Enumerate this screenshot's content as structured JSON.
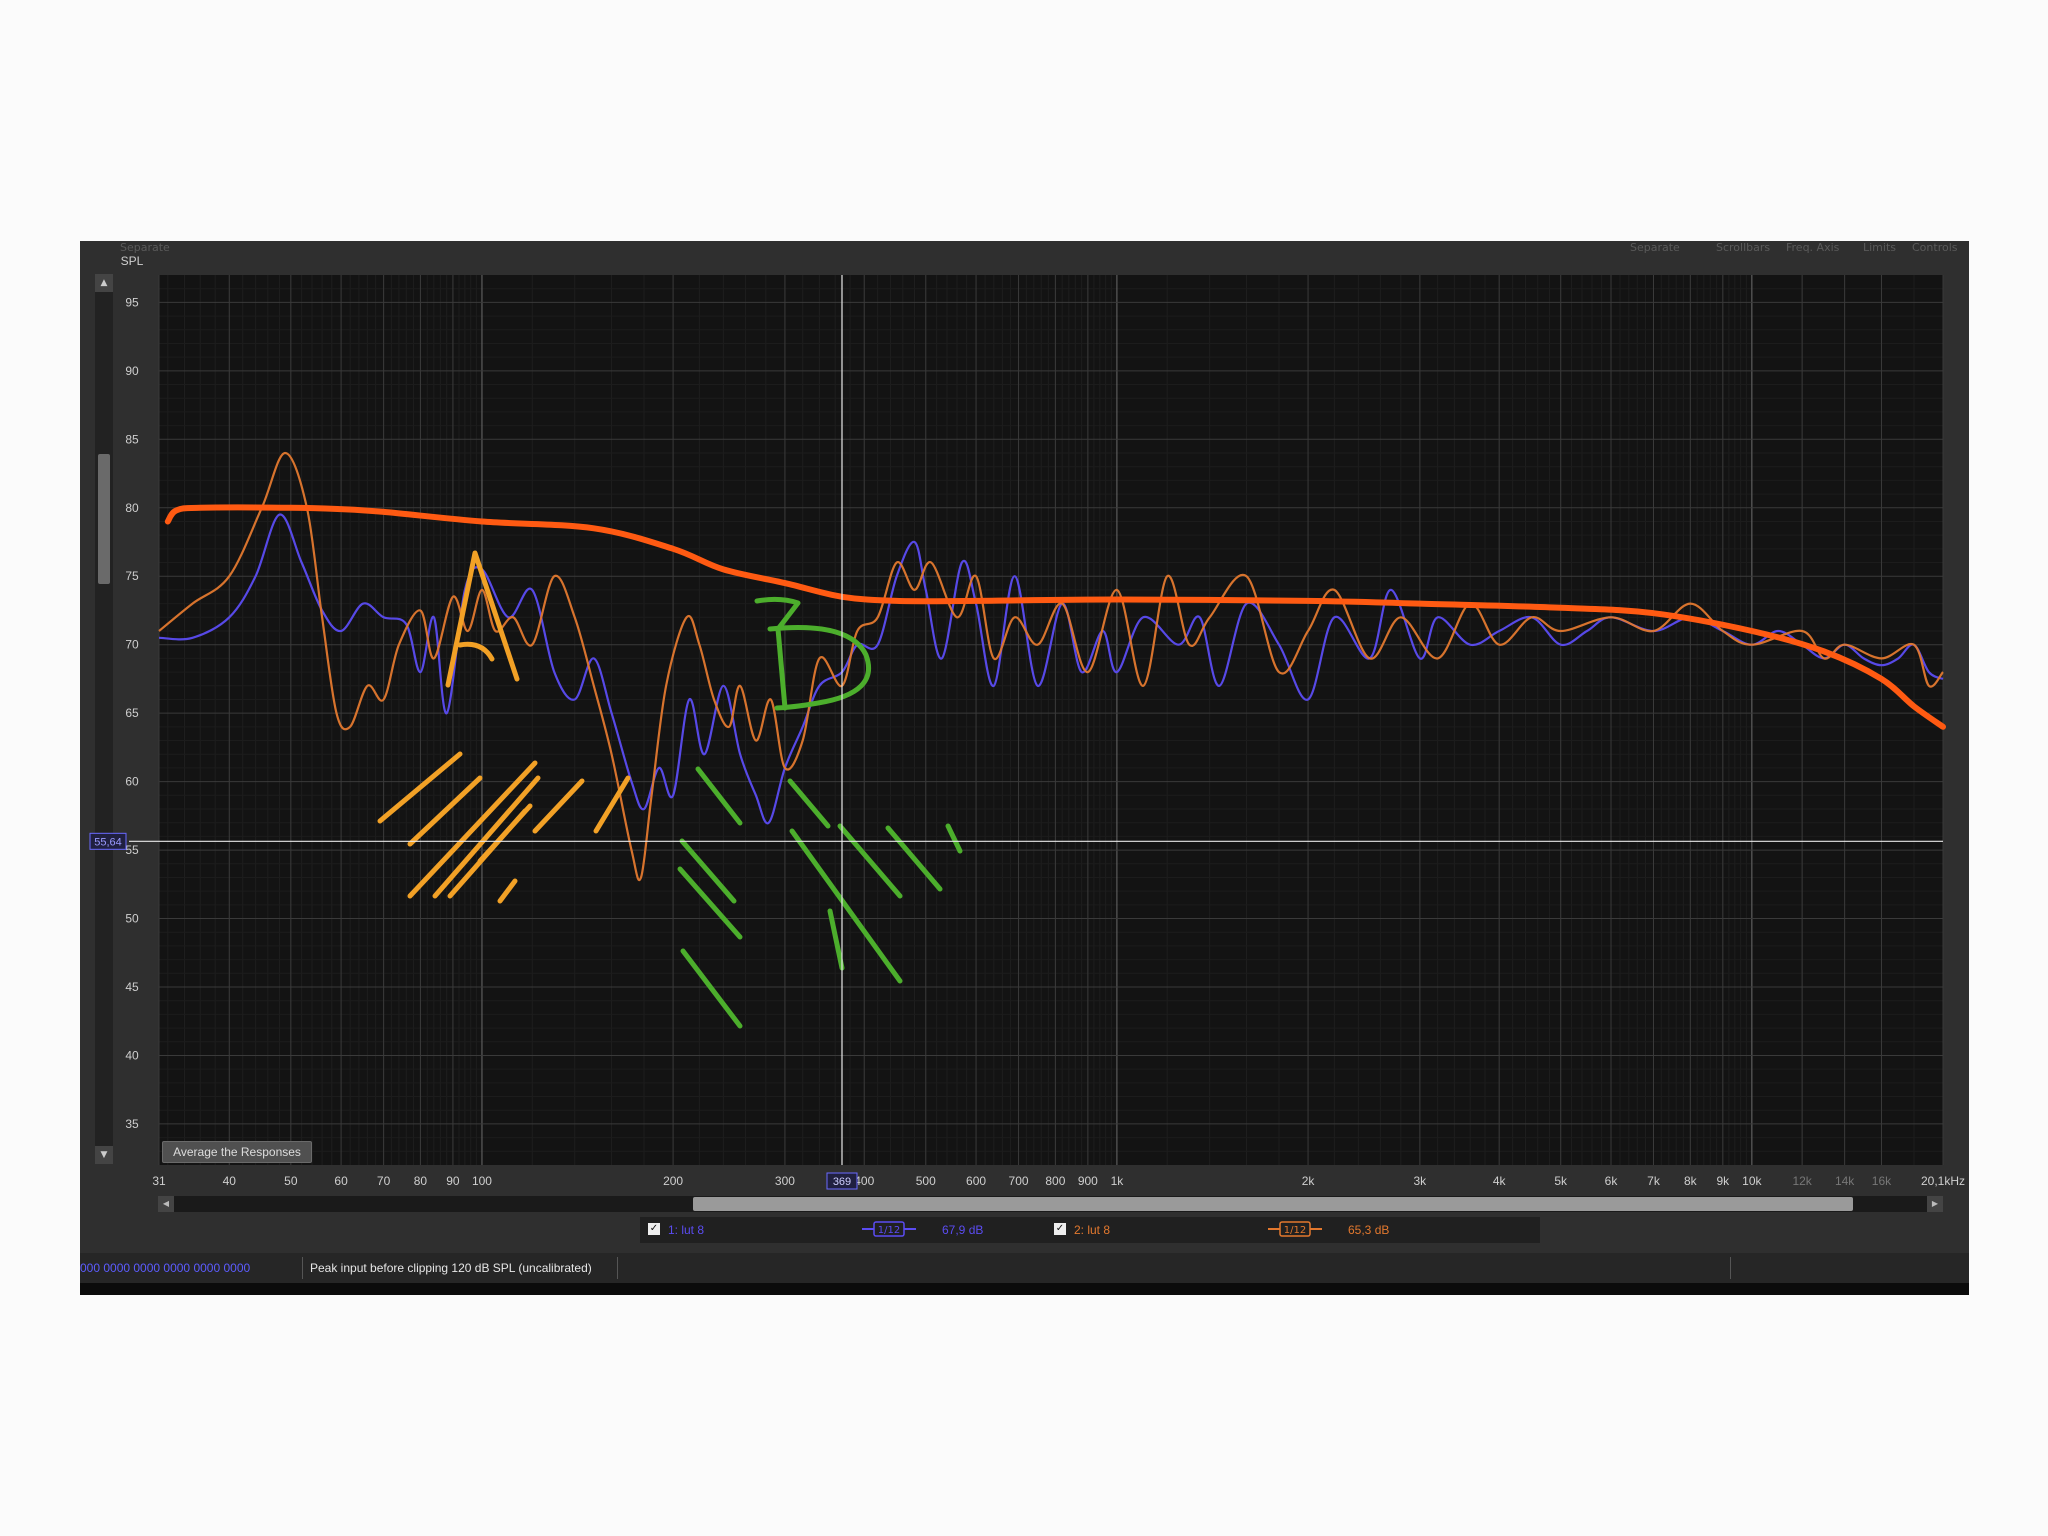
{
  "toolbar": {
    "left_label": "Separate",
    "right_labels": [
      "Separate",
      "Scrollbars",
      "Freq. Axis",
      "Limits",
      "Controls"
    ]
  },
  "colors": {
    "series1": "#5b4cf2",
    "series2": "#e2782e",
    "average": "#ff5a12",
    "annotation_a": "#f2a126",
    "annotation_b": "#4cae2c",
    "grid": "#3a3a3a",
    "plot_bg": "#131313"
  },
  "chart_data": {
    "type": "line",
    "xscale": "log",
    "xlim": [
      31,
      20000
    ],
    "ylim": [
      32,
      97
    ],
    "ylabel": "SPL",
    "yticks": [
      35,
      40,
      45,
      50,
      55,
      60,
      65,
      70,
      75,
      80,
      85,
      90,
      95
    ],
    "xticks": [
      {
        "v": 31,
        "l": "31"
      },
      {
        "v": 40,
        "l": "40"
      },
      {
        "v": 50,
        "l": "50"
      },
      {
        "v": 60,
        "l": "60"
      },
      {
        "v": 70,
        "l": "70"
      },
      {
        "v": 80,
        "l": "80"
      },
      {
        "v": 90,
        "l": "90"
      },
      {
        "v": 100,
        "l": "100"
      },
      {
        "v": 200,
        "l": "200"
      },
      {
        "v": 300,
        "l": "300"
      },
      {
        "v": 400,
        "l": "400"
      },
      {
        "v": 500,
        "l": "500"
      },
      {
        "v": 600,
        "l": "600"
      },
      {
        "v": 700,
        "l": "700"
      },
      {
        "v": 800,
        "l": "800"
      },
      {
        "v": 900,
        "l": "900"
      },
      {
        "v": 1000,
        "l": "1k"
      },
      {
        "v": 2000,
        "l": "2k"
      },
      {
        "v": 3000,
        "l": "3k"
      },
      {
        "v": 4000,
        "l": "4k"
      },
      {
        "v": 5000,
        "l": "5k"
      },
      {
        "v": 6000,
        "l": "6k"
      },
      {
        "v": 7000,
        "l": "7k"
      },
      {
        "v": 8000,
        "l": "8k"
      },
      {
        "v": 9000,
        "l": "9k"
      },
      {
        "v": 10000,
        "l": "10k"
      },
      {
        "v": 12000,
        "l": "12k"
      },
      {
        "v": 14000,
        "l": "14k"
      },
      {
        "v": 16000,
        "l": "16k"
      },
      {
        "v": 20000,
        "l": "20,1kHz"
      }
    ],
    "cursor": {
      "x": 369,
      "x_label": "369",
      "y": 55.64,
      "y_label": "55,64"
    },
    "series": [
      {
        "name": "1: lut 8",
        "smoothing": "1/12",
        "level": "67,9 dB",
        "points": [
          [
            31,
            70.5
          ],
          [
            35,
            70.5
          ],
          [
            40,
            72
          ],
          [
            44,
            75
          ],
          [
            48,
            79.5
          ],
          [
            52,
            76
          ],
          [
            56,
            72.5
          ],
          [
            60,
            71
          ],
          [
            65,
            73
          ],
          [
            70,
            72
          ],
          [
            76,
            71.5
          ],
          [
            80,
            68
          ],
          [
            84,
            72
          ],
          [
            88,
            65
          ],
          [
            94,
            74
          ],
          [
            100,
            75.5
          ],
          [
            110,
            72
          ],
          [
            120,
            74
          ],
          [
            130,
            68
          ],
          [
            140,
            66
          ],
          [
            150,
            69
          ],
          [
            160,
            65
          ],
          [
            172,
            60
          ],
          [
            180,
            58
          ],
          [
            190,
            61
          ],
          [
            200,
            59
          ],
          [
            212,
            66
          ],
          [
            224,
            62
          ],
          [
            240,
            67
          ],
          [
            255,
            62
          ],
          [
            270,
            59
          ],
          [
            283,
            57
          ],
          [
            300,
            61
          ],
          [
            320,
            64
          ],
          [
            340,
            67
          ],
          [
            369,
            68
          ],
          [
            390,
            70
          ],
          [
            420,
            70
          ],
          [
            450,
            75
          ],
          [
            480,
            77.5
          ],
          [
            500,
            74
          ],
          [
            530,
            69
          ],
          [
            570,
            76
          ],
          [
            600,
            73
          ],
          [
            640,
            67
          ],
          [
            690,
            75
          ],
          [
            750,
            67
          ],
          [
            820,
            73
          ],
          [
            880,
            68
          ],
          [
            950,
            71
          ],
          [
            1000,
            68
          ],
          [
            1100,
            72
          ],
          [
            1250,
            70
          ],
          [
            1350,
            72
          ],
          [
            1450,
            67
          ],
          [
            1600,
            73
          ],
          [
            1800,
            70
          ],
          [
            2000,
            66
          ],
          [
            2200,
            72
          ],
          [
            2500,
            69
          ],
          [
            2700,
            74
          ],
          [
            3000,
            69
          ],
          [
            3200,
            72
          ],
          [
            3600,
            70
          ],
          [
            4000,
            71
          ],
          [
            4500,
            72
          ],
          [
            5000,
            70
          ],
          [
            5500,
            71
          ],
          [
            6000,
            72
          ],
          [
            7000,
            71
          ],
          [
            8000,
            72
          ],
          [
            9000,
            71
          ],
          [
            10000,
            70
          ],
          [
            11000,
            71
          ],
          [
            12000,
            70
          ],
          [
            13000,
            69
          ],
          [
            14000,
            70
          ],
          [
            15000,
            69
          ],
          [
            16000,
            68.5
          ],
          [
            17000,
            69
          ],
          [
            18000,
            70
          ],
          [
            19000,
            68
          ],
          [
            20000,
            67.5
          ]
        ]
      },
      {
        "name": "2: lut 8",
        "smoothing": "1/12",
        "level": "65,3 dB",
        "points": [
          [
            31,
            71
          ],
          [
            35,
            73
          ],
          [
            40,
            75
          ],
          [
            45,
            80
          ],
          [
            49,
            84
          ],
          [
            53,
            80
          ],
          [
            56,
            72
          ],
          [
            59,
            65
          ],
          [
            62,
            64
          ],
          [
            66,
            67
          ],
          [
            70,
            66
          ],
          [
            74,
            70
          ],
          [
            80,
            72.5
          ],
          [
            84,
            69
          ],
          [
            90,
            73.5
          ],
          [
            95,
            71
          ],
          [
            100,
            74
          ],
          [
            105,
            71
          ],
          [
            112,
            72
          ],
          [
            120,
            70
          ],
          [
            130,
            75
          ],
          [
            140,
            72
          ],
          [
            150,
            67
          ],
          [
            160,
            62
          ],
          [
            172,
            55
          ],
          [
            178,
            53
          ],
          [
            185,
            59
          ],
          [
            195,
            67
          ],
          [
            210,
            72
          ],
          [
            220,
            70
          ],
          [
            232,
            66
          ],
          [
            245,
            64
          ],
          [
            255,
            67
          ],
          [
            270,
            63
          ],
          [
            285,
            66
          ],
          [
            300,
            61
          ],
          [
            320,
            63
          ],
          [
            340,
            69
          ],
          [
            369,
            67
          ],
          [
            390,
            71
          ],
          [
            420,
            72
          ],
          [
            450,
            76
          ],
          [
            480,
            74
          ],
          [
            510,
            76
          ],
          [
            560,
            72
          ],
          [
            600,
            75
          ],
          [
            640,
            69
          ],
          [
            690,
            72
          ],
          [
            750,
            70
          ],
          [
            820,
            73
          ],
          [
            900,
            68
          ],
          [
            1000,
            74
          ],
          [
            1100,
            67
          ],
          [
            1200,
            75
          ],
          [
            1300,
            70
          ],
          [
            1400,
            72
          ],
          [
            1600,
            75
          ],
          [
            1800,
            68
          ],
          [
            2000,
            71
          ],
          [
            2200,
            74
          ],
          [
            2500,
            69
          ],
          [
            2800,
            72
          ],
          [
            3200,
            69
          ],
          [
            3600,
            73
          ],
          [
            4000,
            70
          ],
          [
            4500,
            72
          ],
          [
            5000,
            71
          ],
          [
            6000,
            72
          ],
          [
            7000,
            71
          ],
          [
            8000,
            73
          ],
          [
            9000,
            71
          ],
          [
            10000,
            70
          ],
          [
            12000,
            71
          ],
          [
            13000,
            69
          ],
          [
            14000,
            70
          ],
          [
            16000,
            69
          ],
          [
            18000,
            70
          ],
          [
            19000,
            67
          ],
          [
            20000,
            68
          ]
        ]
      }
    ],
    "average": {
      "points": [
        [
          32,
          79
        ],
        [
          33,
          79.8
        ],
        [
          36,
          80
        ],
        [
          50,
          80
        ],
        [
          60,
          79.9
        ],
        [
          70,
          79.7
        ],
        [
          100,
          79
        ],
        [
          150,
          78.5
        ],
        [
          200,
          77
        ],
        [
          240,
          75.5
        ],
        [
          300,
          74.5
        ],
        [
          369,
          73.5
        ],
        [
          450,
          73.2
        ],
        [
          600,
          73.2
        ],
        [
          1000,
          73.3
        ],
        [
          2000,
          73.2
        ],
        [
          3000,
          73
        ],
        [
          5000,
          72.7
        ],
        [
          7000,
          72.3
        ],
        [
          10000,
          71
        ],
        [
          13000,
          69.5
        ],
        [
          16000,
          67.5
        ],
        [
          18000,
          65.5
        ],
        [
          20000,
          64
        ]
      ]
    },
    "annotations": [
      {
        "label": "A",
        "color": "#f2a126"
      },
      {
        "label": "B",
        "color": "#4cae2c"
      }
    ]
  },
  "buttons": {
    "average": "Average the Responses"
  },
  "legend": {
    "items": [
      {
        "checked": true,
        "label": "1: lut 8",
        "smoothing": "1/12",
        "level": "67,9 dB"
      },
      {
        "checked": true,
        "label": "2: lut 8",
        "smoothing": "1/12",
        "level": "65,3 dB"
      }
    ]
  },
  "status": {
    "counters": "000 0000   0000 0000   0000 0000",
    "message": "Peak input before clipping 120 dB SPL (uncalibrated)"
  }
}
